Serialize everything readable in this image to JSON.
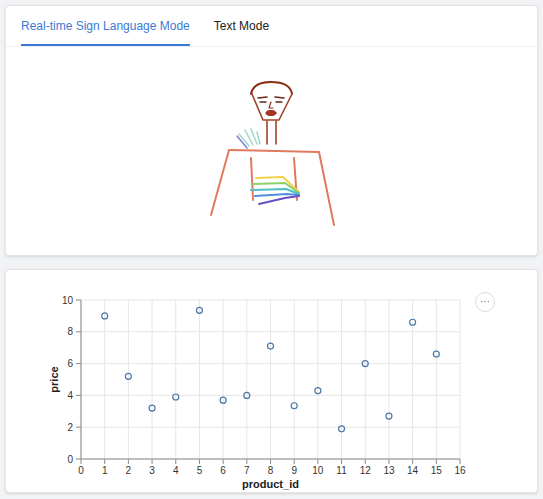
{
  "tabs": [
    {
      "label": "Real-time Sign Language Mode",
      "selected": true
    },
    {
      "label": "Text Mode",
      "selected": false
    }
  ],
  "chart": {
    "menu": "···",
    "x_axis": {
      "label": "product_id",
      "ticks": [
        "0",
        "1",
        "2",
        "3",
        "4",
        "5",
        "6",
        "7",
        "8",
        "9",
        "10",
        "11",
        "12",
        "13",
        "14",
        "15",
        "16"
      ]
    },
    "y_axis": {
      "label": "price",
      "ticks": [
        "0",
        "2",
        "4",
        "6",
        "8",
        "10"
      ]
    },
    "series": [
      {
        "x": [
          1,
          2,
          3,
          4,
          5,
          6,
          7,
          8,
          9,
          10,
          11,
          12,
          13,
          14,
          15
        ],
        "y": [
          9.0,
          5.2,
          3.2,
          3.9,
          9.35,
          3.7,
          4.0,
          7.1,
          3.35,
          4.3,
          1.9,
          6.0,
          2.7,
          8.6,
          6.6
        ]
      }
    ]
  }
}
